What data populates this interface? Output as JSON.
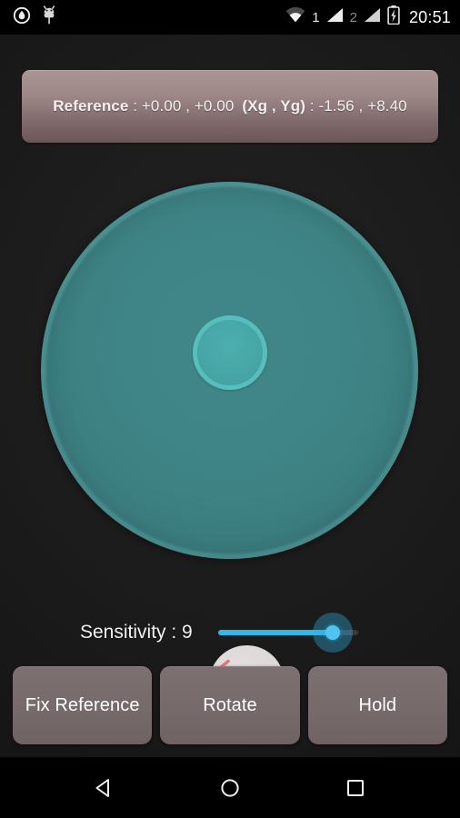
{
  "statusbar": {
    "left_icons": [
      {
        "name": "gps-droplet-icon",
        "glyph": "droplet"
      },
      {
        "name": "android-bug-icon",
        "glyph": "bug"
      }
    ],
    "wifi_icon": "wifi-icon",
    "sim1_label": "1",
    "sim1_signal_icon": "signal-bars-icon",
    "sim2_label": "2",
    "sim2_signal_icon": "signal-bars-icon",
    "battery_icon": "battery-charging-icon",
    "clock": "20:51"
  },
  "reference_bar": {
    "label": "Reference",
    "separator": " : ",
    "value_x": "+0.00",
    "value_y": "+0.00",
    "comma": " , ",
    "g_label": "(Xg , Yg)",
    "g_value_x": "-1.56",
    "g_value_y": "+8.40",
    "full_text": "Reference : +0.00 , +0.00  (Xg , Yg) : -1.56 , +8.40"
  },
  "dial": {
    "name": "bubble-level-dial",
    "dial_color": "#3e8284",
    "rim_color": "#7dc8c8",
    "target_fill": "#47a5a6",
    "target_ring": "#56bfbd",
    "bubble_color": "#ddd7d7",
    "arrow_color": "#e07a7a",
    "arrow_directions": "left, down"
  },
  "sensitivity": {
    "label": "Sensitivity : 9",
    "value": 9,
    "min": 1,
    "max": 9,
    "accent_color": "#33b5e5"
  },
  "buttons": [
    {
      "name": "fix-reference-button",
      "label": "Fix Reference"
    },
    {
      "name": "rotate-button",
      "label": "Rotate"
    },
    {
      "name": "hold-button",
      "label": "Hold"
    }
  ],
  "navbar": {
    "back": "back-nav-icon",
    "home": "home-nav-icon",
    "recents": "recents-nav-icon"
  }
}
